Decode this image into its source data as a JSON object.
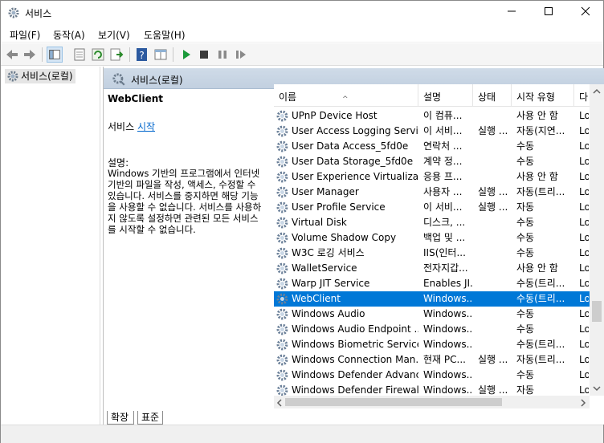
{
  "window": {
    "title": "서비스"
  },
  "menu": [
    "파일(F)",
    "동작(A)",
    "보기(V)",
    "도움말(H)"
  ],
  "tree": {
    "root": "서비스(로컬)"
  },
  "panel": {
    "header": "서비스(로컬)"
  },
  "detail": {
    "service_name": "WebClient",
    "start_prefix": "서비스",
    "start_link": "시작",
    "desc_label": "설명:",
    "desc_text": "Windows 기반의 프로그램에서 인터넷 기반의 파일을 작성, 액세스, 수정할 수 있습니다. 서비스를 중지하면 해당 기능을 사용할 수 없습니다. 서비스를 사용하지 않도록 설정하면 관련된 모든 서비스를 시작할 수 없습니다."
  },
  "columns": [
    "이름",
    "설명",
    "상태",
    "시작 유형",
    "다"
  ],
  "rows": [
    [
      "UPnP Device Host",
      "이 컴퓨...",
      "",
      "사용 안 함",
      "Lo"
    ],
    [
      "User Access Logging Service",
      "이 서비...",
      "실행 ...",
      "자동(지연...",
      "Lo"
    ],
    [
      "User Data Access_5fd0e",
      "연락처 ...",
      "",
      "수동",
      "Lo"
    ],
    [
      "User Data Storage_5fd0e",
      "계약 정...",
      "",
      "수동",
      "Lo"
    ],
    [
      "User Experience Virtualizati...",
      "응용 프...",
      "",
      "사용 안 함",
      "Lo"
    ],
    [
      "User Manager",
      "사용자 ...",
      "실행 ...",
      "자동(트리...",
      "Lo"
    ],
    [
      "User Profile Service",
      "이 서비...",
      "실행 ...",
      "자동",
      "Lo"
    ],
    [
      "Virtual Disk",
      "디스크, ...",
      "",
      "수동",
      "Lo"
    ],
    [
      "Volume Shadow Copy",
      "백업 및 ...",
      "",
      "수동",
      "Lo"
    ],
    [
      "W3C 로깅 서비스",
      "IIS(인터...",
      "",
      "수동",
      "Lo"
    ],
    [
      "WalletService",
      "전자지갑...",
      "",
      "사용 안 함",
      "Lo"
    ],
    [
      "Warp JIT Service",
      "Enables JI...",
      "",
      "수동(트리...",
      "Lo"
    ],
    [
      "WebClient",
      "Windows...",
      "",
      "수동(트리...",
      "Lo"
    ],
    [
      "Windows Audio",
      "Windows...",
      "",
      "수동",
      "Lo"
    ],
    [
      "Windows Audio Endpoint ...",
      "Windows...",
      "",
      "수동",
      "Lo"
    ],
    [
      "Windows Biometric Service",
      "Windows...",
      "",
      "수동(트리...",
      "Lo"
    ],
    [
      "Windows Connection Man...",
      "현재 PC...",
      "실행 ...",
      "자동(트리...",
      "Lo"
    ],
    [
      "Windows Defender Advanc...",
      "Windows...",
      "",
      "수동",
      "Lo"
    ],
    [
      "Windows Defender Firewall",
      "Windows...",
      "실행 ...",
      "자동",
      "Lo"
    ]
  ],
  "selected_row": 12,
  "tabs": [
    "확장",
    "표준"
  ],
  "colors": {
    "selection": "#0078d7",
    "header_bg": "#c7d4e3",
    "link": "#0066cc"
  }
}
